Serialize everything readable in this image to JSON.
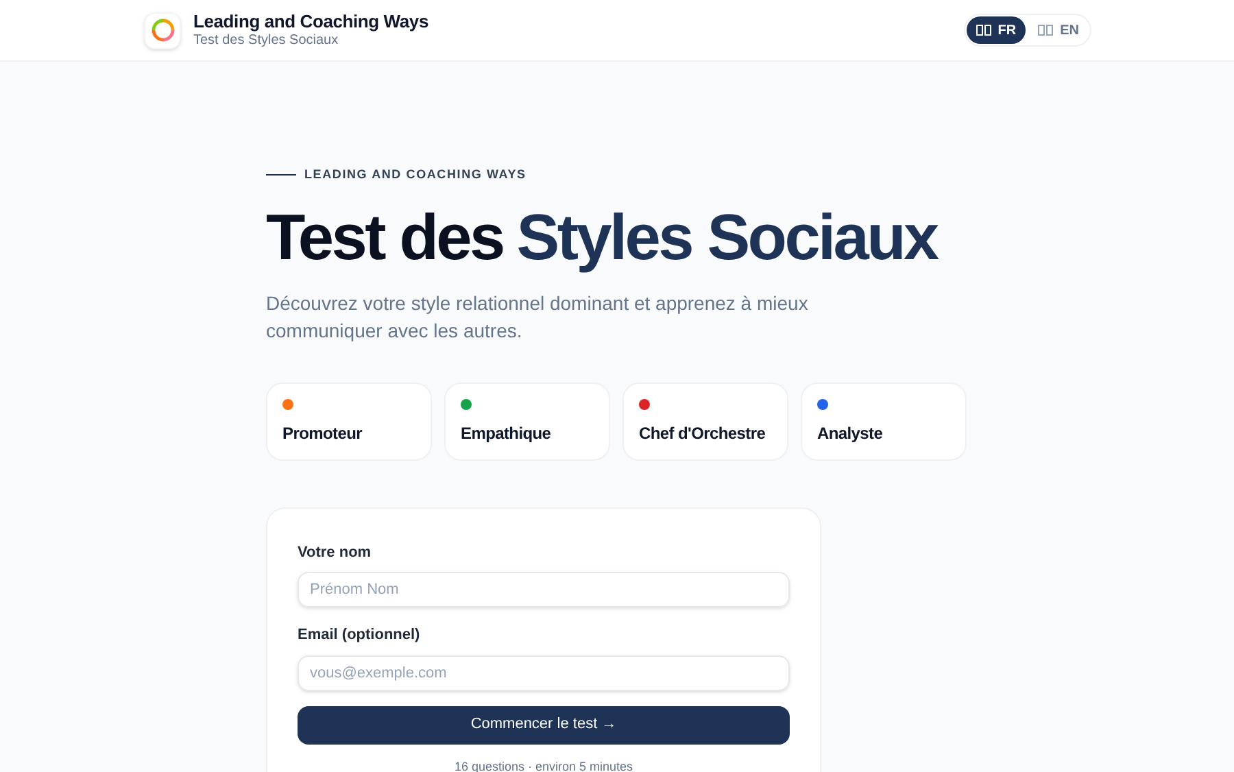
{
  "header": {
    "brand": "Leading and Coaching Ways",
    "subtitle": "Test des Styles Sociaux",
    "languages": [
      {
        "label": "FR",
        "selected": true
      },
      {
        "label": "EN",
        "selected": false
      }
    ]
  },
  "hero": {
    "eyebrow": "LEADING AND COACHING WAYS",
    "title_lead": "Test des",
    "title_accent": "Styles Sociaux",
    "description": "Découvrez votre style relationnel dominant et apprenez à mieux communiquer avec les autres."
  },
  "styles": [
    {
      "name": "Promoteur",
      "color": "#f97316"
    },
    {
      "name": "Empathique",
      "color": "#16a34a"
    },
    {
      "name": "Chef d'Orchestre",
      "color": "#dc2626"
    },
    {
      "name": "Analyste",
      "color": "#2563eb"
    }
  ],
  "form": {
    "fields": [
      {
        "label": "Votre nom",
        "placeholder": "Prénom Nom"
      },
      {
        "label": "Email (optionnel)",
        "placeholder": "vous@exemple.com"
      }
    ],
    "button": "Commencer le test →",
    "note": "16 questions · environ 5 minutes"
  }
}
